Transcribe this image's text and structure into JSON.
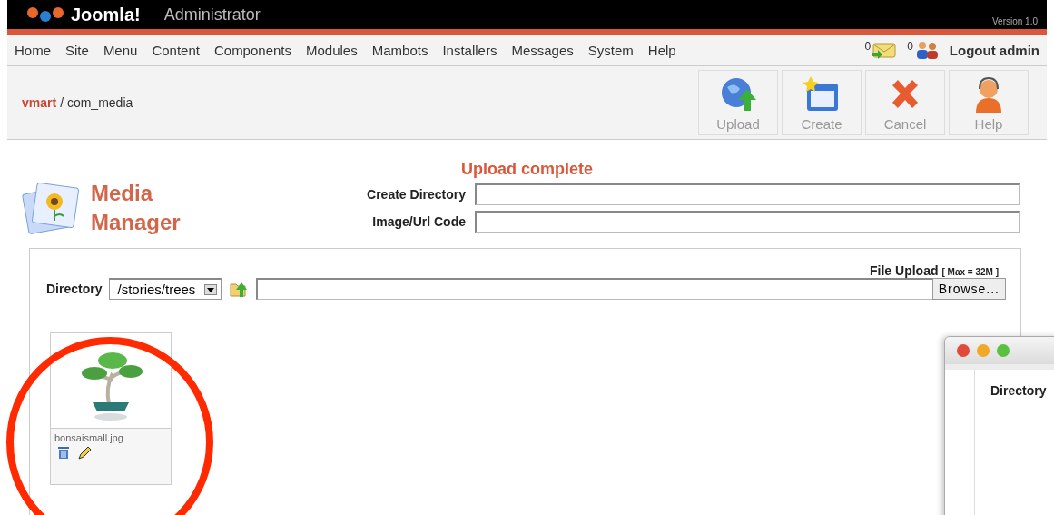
{
  "header": {
    "logo": "Joomla!",
    "subtitle": "Administrator",
    "version": "Version 1.0"
  },
  "menu": {
    "items": [
      "Home",
      "Site",
      "Menu",
      "Content",
      "Components",
      "Modules",
      "Mambots",
      "Installers",
      "Messages",
      "System",
      "Help"
    ],
    "messages_count": "0",
    "users_count": "0",
    "logout": "Logout admin"
  },
  "breadcrumb": {
    "link": "vmart",
    "rest": "/ com_media"
  },
  "toolbar": [
    {
      "label": "Upload",
      "kind": "upload"
    },
    {
      "label": "Create",
      "kind": "create"
    },
    {
      "label": "Cancel",
      "kind": "cancel"
    },
    {
      "label": "Help",
      "kind": "help"
    }
  ],
  "status": "Upload complete",
  "title": [
    "Media",
    "Manager"
  ],
  "form": [
    {
      "label": "Create Directory"
    },
    {
      "label": "Image/Url Code"
    }
  ],
  "directory": {
    "label": "Directory",
    "value": "/stories/trees"
  },
  "upload": {
    "label": "File Upload",
    "limit": "[ Max = 32M ]",
    "browse": "Browse..."
  },
  "files": [
    {
      "name": "bonsaismall.jpg"
    }
  ],
  "overlay_window": {
    "label": "Directory"
  }
}
